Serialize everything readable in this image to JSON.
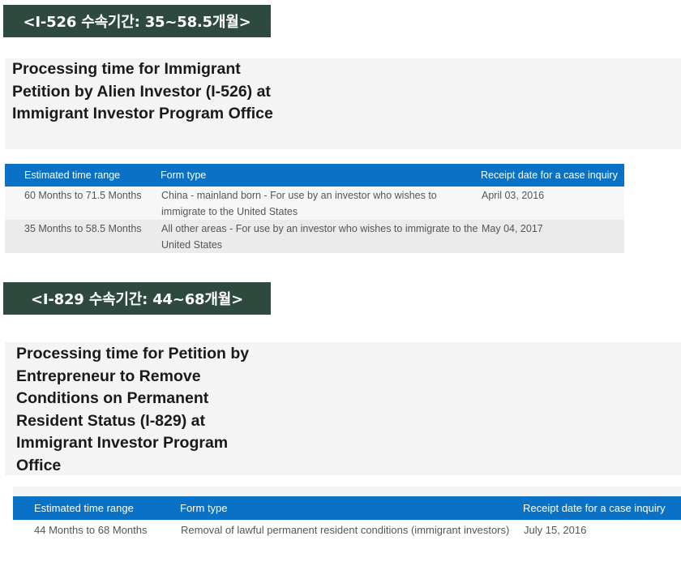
{
  "sections": [
    {
      "banner": "<I-526 수속기간: 35~58.5개월>",
      "title": "Processing time for Immigrant Petition by Alien Investor (I-526) at Immigrant Investor Program Office",
      "table": {
        "headers": [
          "Estimated time range",
          "Form type",
          "Receipt date for a case inquiry"
        ],
        "rows": [
          {
            "range": "60 Months to 71.5 Months",
            "form": "China - mainland born - For use by an investor who wishes to immigrate to the United States",
            "date": "April 03, 2016"
          },
          {
            "range": "35 Months to 58.5 Months",
            "form": "All other areas - For use by an investor who wishes to immigrate to the United States",
            "date": "May 04, 2017"
          }
        ]
      }
    },
    {
      "banner": "<I-829 수속기간: 44~68개월>",
      "title": "Processing time for Petition by Entrepreneur to Remove Conditions on Permanent Resident Status (I-829) at Immigrant Investor Program Office",
      "table": {
        "headers": [
          "Estimated time range",
          "Form type",
          "Receipt date for a case inquiry"
        ],
        "rows": [
          {
            "range": "44 Months to 68 Months",
            "form": "Removal of lawful permanent resident conditions (immigrant investors)",
            "date": "July 15, 2016"
          }
        ]
      }
    }
  ],
  "colors": {
    "banner_bg": "#2e4a3f",
    "header_bg": "#0a72c6",
    "panel_bg": "#f4f4f4"
  }
}
